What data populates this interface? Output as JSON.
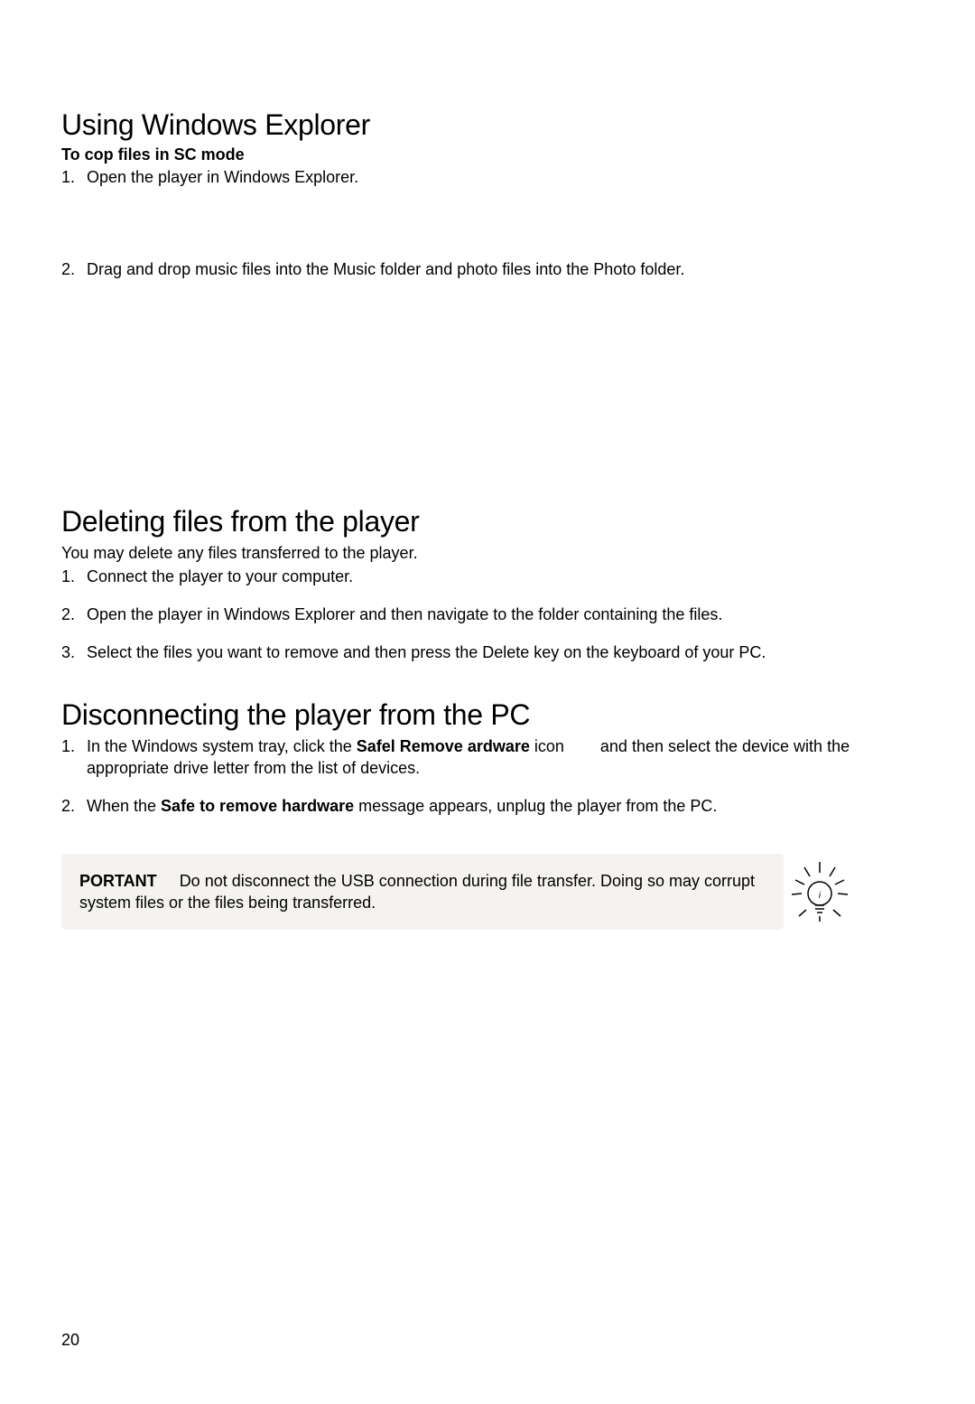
{
  "section1": {
    "heading": "Using Windows Explorer",
    "subheading": "To cop  files in  SC mode",
    "steps": [
      "Open the player in Windows Explorer.",
      "Drag and drop music files into the Music folder and photo files into the Photo folder."
    ]
  },
  "section2": {
    "heading": "Deleting files from the player",
    "intro": "You may delete any files transferred to the player.",
    "steps": [
      "Connect the player to your computer.",
      "Open the player in Windows Explorer and then navigate to the folder containing the files.",
      "Select the files you want to remove and then press the Delete key on the keyboard of your PC."
    ]
  },
  "section3": {
    "heading": "Disconnecting the player from the PC",
    "step1_prefix": "In the Windows system tray, click the ",
    "step1_bold": "Safel  Remove  ardware",
    "step1_mid": " icon ",
    "step1_suffix": " and then select the device with the appropriate drive letter from the list of devices.",
    "step2_prefix": "When the ",
    "step2_bold": "Safe to remove hardware",
    "step2_suffix": " message appears, unplug the player from the PC."
  },
  "callout": {
    "label": " PORTANT ",
    "text": "Do not disconnect the USB connection during file transfer. Doing so may corrupt system files or the files being transferred."
  },
  "page_number": "20"
}
